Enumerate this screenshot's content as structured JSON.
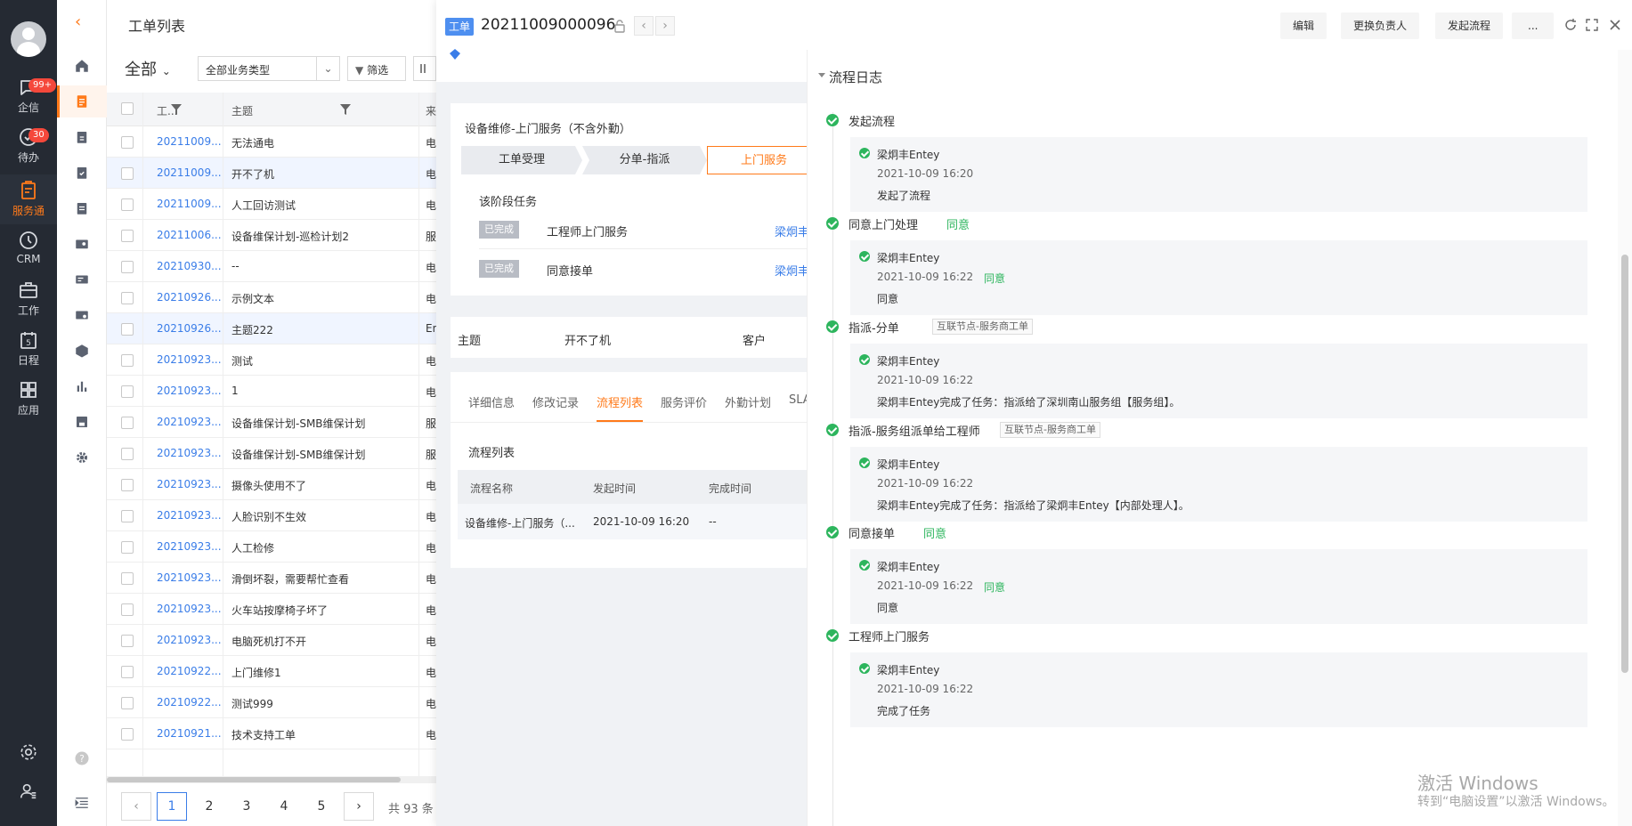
{
  "nav": {
    "items": [
      {
        "label": "企信",
        "badge": "99+",
        "icon": "chat-icon"
      },
      {
        "label": "待办",
        "badge": "30",
        "icon": "check-circle-icon"
      },
      {
        "label": "服务通",
        "badge": "",
        "icon": "service-icon"
      },
      {
        "label": "CRM",
        "badge": "",
        "icon": "clock-icon"
      },
      {
        "label": "工作",
        "badge": "",
        "icon": "briefcase-icon"
      },
      {
        "label": "日程",
        "badge": "",
        "icon": "calendar-icon"
      },
      {
        "label": "应用",
        "badge": "",
        "icon": "grid-icon"
      }
    ],
    "calendar_day": "5"
  },
  "list": {
    "title": "工单列表",
    "scope": "全部",
    "type_select": "全部业务类型",
    "filter_label": "筛选",
    "col_id": "工...",
    "col_subject": "主题",
    "col_source": "来",
    "rows": [
      {
        "id": "20211009...",
        "subject": "无法通电",
        "src": "电"
      },
      {
        "id": "20211009...",
        "subject": "开不了机",
        "src": "电"
      },
      {
        "id": "20211009...",
        "subject": "人工回访测试",
        "src": "电"
      },
      {
        "id": "20211006...",
        "subject": "设备维保计划-巡检计划2",
        "src": "服"
      },
      {
        "id": "20210930...",
        "subject": "--",
        "src": "电"
      },
      {
        "id": "20210926...",
        "subject": "示例文本",
        "src": "电"
      },
      {
        "id": "20210926...",
        "subject": "主题222",
        "src": "En"
      },
      {
        "id": "20210923...",
        "subject": "测试",
        "src": "电"
      },
      {
        "id": "20210923...",
        "subject": "1",
        "src": "电"
      },
      {
        "id": "20210923...",
        "subject": "设备维保计划-SMB维保计划",
        "src": "服"
      },
      {
        "id": "20210923...",
        "subject": "设备维保计划-SMB维保计划",
        "src": "服"
      },
      {
        "id": "20210923...",
        "subject": "摄像头使用不了",
        "src": "电"
      },
      {
        "id": "20210923...",
        "subject": "人脸识别不生效",
        "src": "电"
      },
      {
        "id": "20210923...",
        "subject": "人工检修",
        "src": "电"
      },
      {
        "id": "20210923...",
        "subject": "滑倒坏裂，需要帮忙查看",
        "src": "电"
      },
      {
        "id": "20210923...",
        "subject": "火车站按摩椅子坏了",
        "src": "电"
      },
      {
        "id": "20210923...",
        "subject": "电脑死机打不开",
        "src": "电"
      },
      {
        "id": "20210922...",
        "subject": "上门维修1",
        "src": "电"
      },
      {
        "id": "20210922...",
        "subject": "测试999",
        "src": "电"
      },
      {
        "id": "20210921...",
        "subject": "技术支持工单",
        "src": "电"
      }
    ],
    "pager": {
      "pages": [
        "1",
        "2",
        "3",
        "4",
        "5"
      ],
      "current": "1",
      "total": "共 93 条"
    }
  },
  "detail": {
    "tag": "工单",
    "number": "20211009000096",
    "buttons": {
      "edit": "编辑",
      "change_owner": "更换负责人",
      "start_flow": "发起流程",
      "more": "..."
    },
    "flow_card": {
      "title": "设备维修-上门服务（不含外勤）",
      "steps": [
        "工单受理",
        "分单-指派",
        "上门服务"
      ],
      "tasks_header": "该阶段任务",
      "tasks": [
        {
          "status": "已完成",
          "name": "工程师上门服务",
          "user": "梁炯丰"
        },
        {
          "status": "已完成",
          "name": "同意接单",
          "user": "梁炯丰"
        }
      ]
    },
    "info": {
      "subject_label": "主题",
      "subject_value": "开不了机",
      "customer_label": "客户"
    },
    "tabs": [
      "详细信息",
      "修改记录",
      "流程列表",
      "服务评价",
      "外勤计划",
      "SLA"
    ],
    "active_tab": "流程列表",
    "process_list": {
      "title": "流程列表",
      "headers": [
        "流程名称",
        "发起时间",
        "完成时间"
      ],
      "rows": [
        {
          "name": "设备维修-上门服务（...",
          "start": "2021-10-09 16:20",
          "end": "--"
        }
      ]
    }
  },
  "log": {
    "title": "流程日志",
    "events": [
      {
        "name": "发起流程",
        "status": "",
        "node": "",
        "user": "梁炯丰Entey",
        "time": "2021-10-09 16:20",
        "box_status": "",
        "desc": "发起了流程"
      },
      {
        "name": "同意上门处理",
        "status": "同意",
        "node": "",
        "user": "梁炯丰Entey",
        "time": "2021-10-09 16:22",
        "box_status": "同意",
        "desc": "同意"
      },
      {
        "name": "指派-分单",
        "status": "",
        "node": "互联节点-服务商工单",
        "user": "梁炯丰Entey",
        "time": "2021-10-09 16:22",
        "box_status": "",
        "desc": "梁炯丰Entey完成了任务：指派给了深圳南山服务组【服务组】。"
      },
      {
        "name": "指派-服务组派单给工程师",
        "status": "",
        "node": "互联节点-服务商工单",
        "user": "梁炯丰Entey",
        "time": "2021-10-09 16:22",
        "box_status": "",
        "desc": "梁炯丰Entey完成了任务：指派给了梁炯丰Entey【内部处理人】。"
      },
      {
        "name": "同意接单",
        "status": "同意",
        "node": "",
        "user": "梁炯丰Entey",
        "time": "2021-10-09 16:22",
        "box_status": "同意",
        "desc": "同意"
      },
      {
        "name": "工程师上门服务",
        "status": "",
        "node": "",
        "user": "梁炯丰Entey",
        "time": "2021-10-09 16:22",
        "box_status": "",
        "desc": "完成了任务"
      }
    ]
  },
  "watermark": {
    "line1": "激活 Windows",
    "line2": "转到“电脑设置”以激活 Windows。"
  },
  "colors": {
    "accent": "#ff7a1a",
    "link": "#3a7de8",
    "success": "#2db55d",
    "nav_bg": "#252a33"
  }
}
